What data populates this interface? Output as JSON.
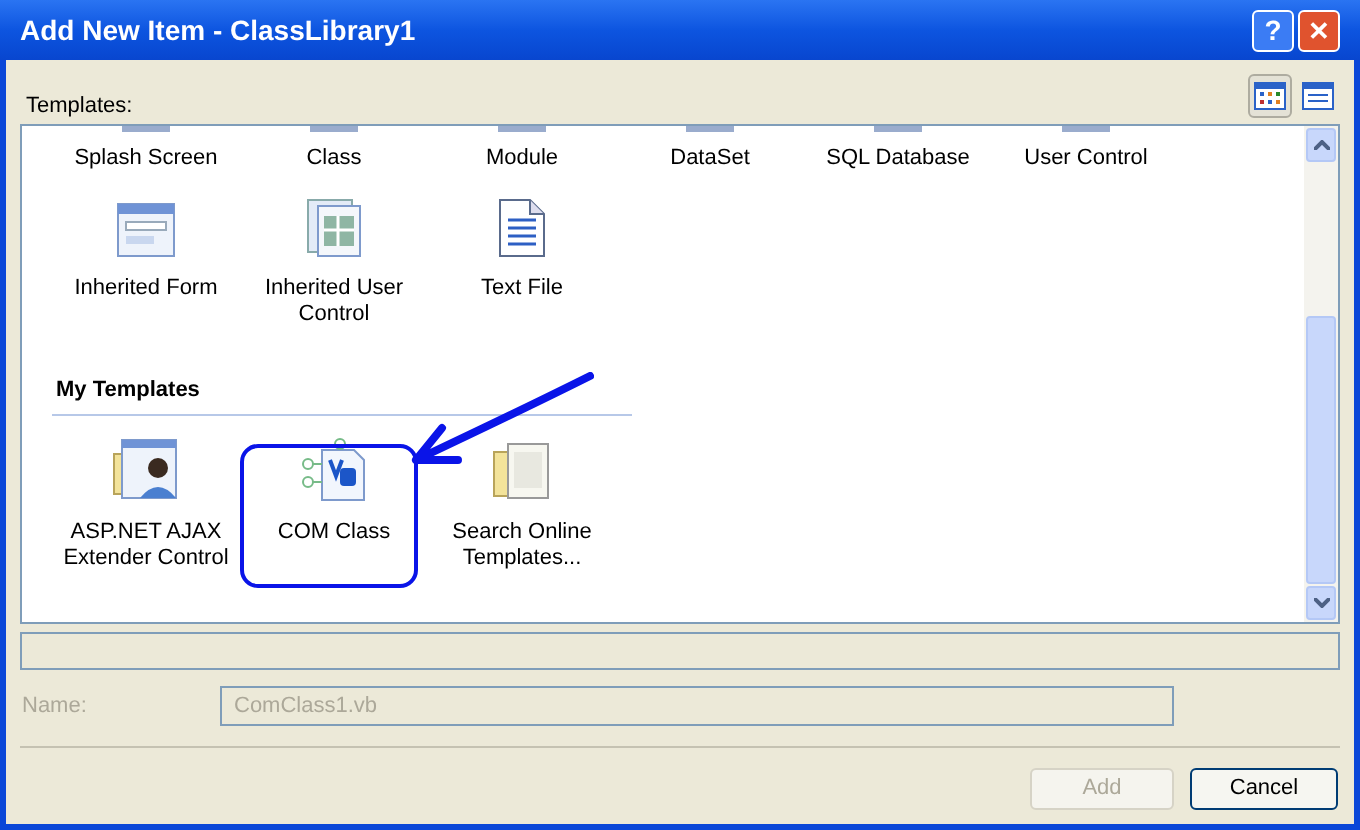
{
  "window": {
    "title": "Add New Item - ClassLibrary1",
    "help_button": "?",
    "close_button": "✕"
  },
  "templates_label": "Templates:",
  "view_buttons": [
    {
      "kind": "large-icons",
      "selected": true
    },
    {
      "kind": "small-icons",
      "selected": false
    }
  ],
  "sections": [
    {
      "items": [
        {
          "label": "Splash Screen",
          "cut": true
        },
        {
          "label": "Class",
          "cut": true
        },
        {
          "label": "Module",
          "cut": true
        },
        {
          "label": "DataSet",
          "cut": true
        },
        {
          "label": "SQL Database",
          "cut": true
        },
        {
          "label": "User Control",
          "cut": true
        }
      ]
    },
    {
      "items": [
        {
          "label": "Inherited Form",
          "cut": false
        },
        {
          "label": "Inherited User Control",
          "cut": false
        },
        {
          "label": "Text File",
          "cut": false
        }
      ]
    },
    {
      "header": "My Templates",
      "items": [
        {
          "label": "ASP.NET AJAX Extender Control",
          "cut": false
        },
        {
          "label": "COM Class",
          "cut": false,
          "circled": true
        },
        {
          "label": "Search Online Templates...",
          "cut": false
        }
      ]
    }
  ],
  "name_field": {
    "label": "Name:",
    "value": "ComClass1.vb",
    "disabled": true
  },
  "buttons": [
    {
      "label": "Add",
      "disabled": true
    },
    {
      "label": "Cancel",
      "disabled": false
    }
  ]
}
